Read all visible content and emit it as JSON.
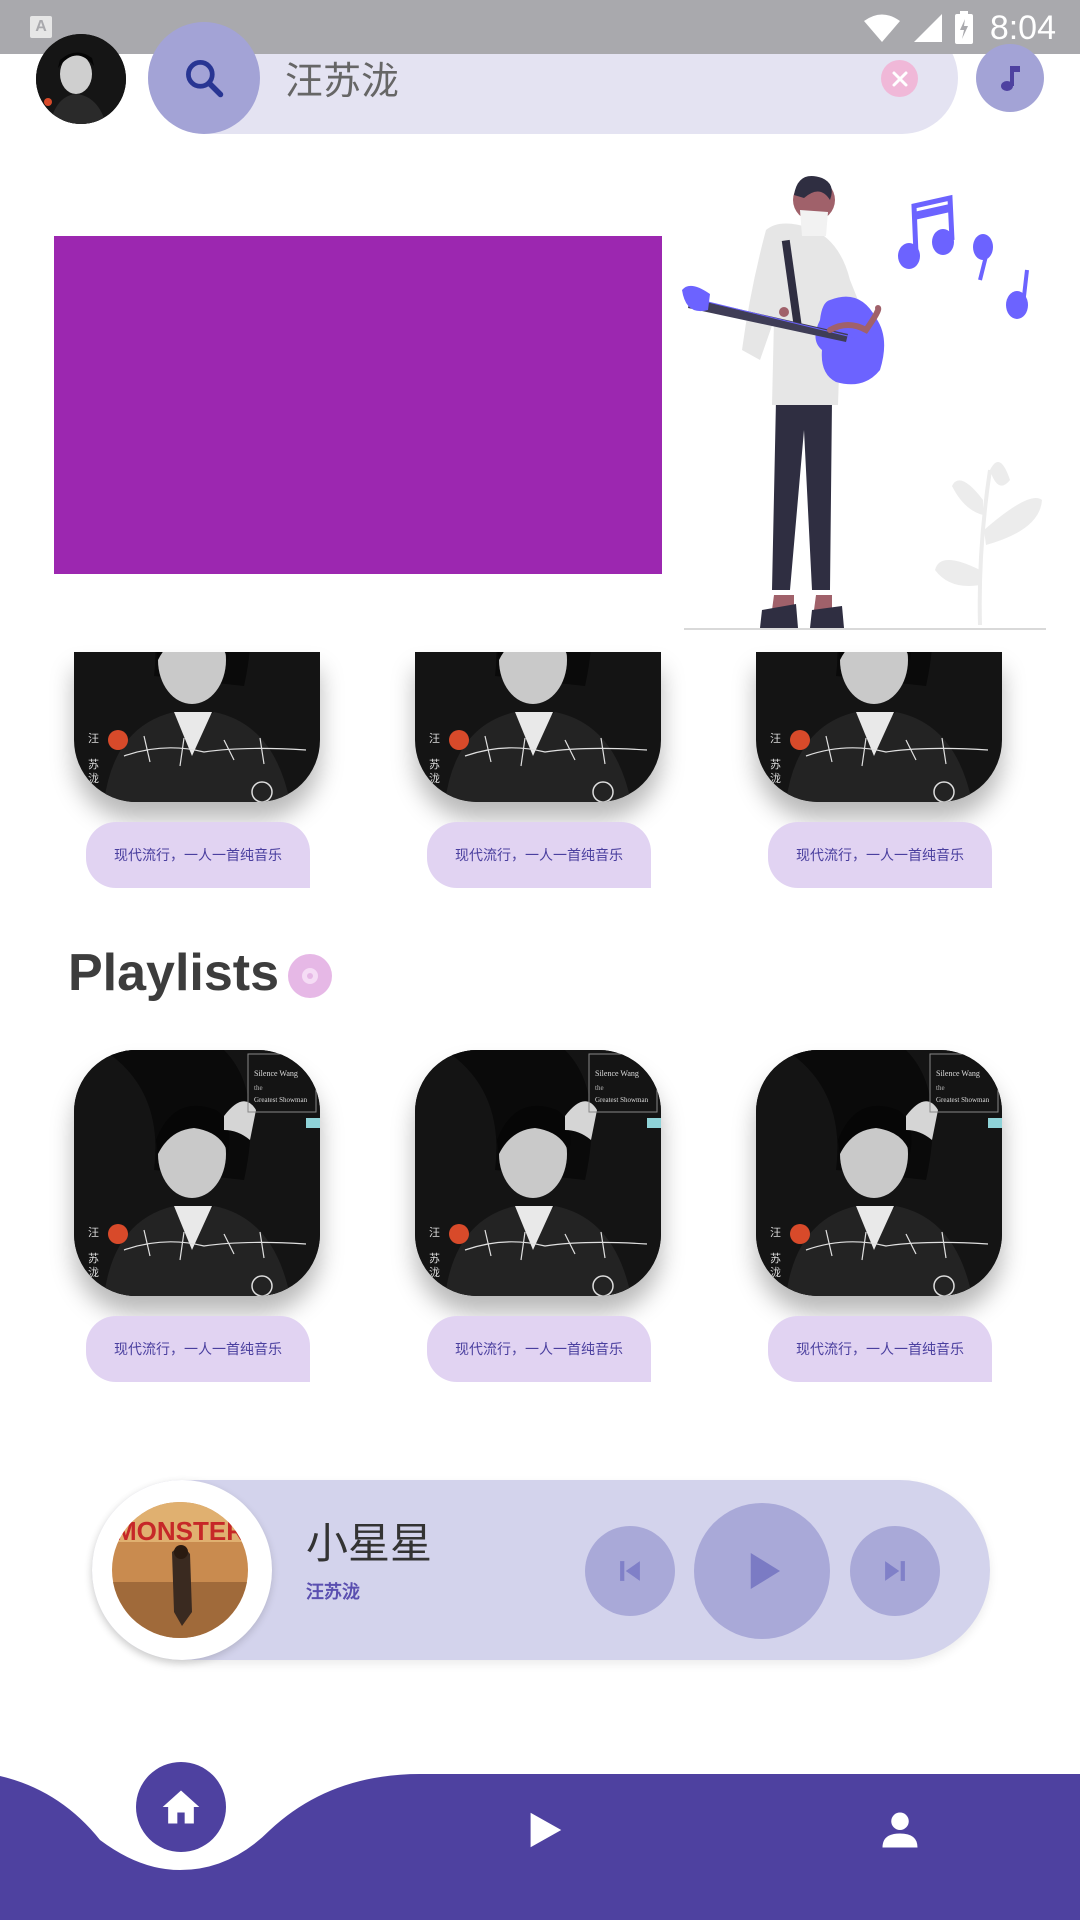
{
  "status_bar": {
    "time": "8:04"
  },
  "search": {
    "query": "汪苏泷"
  },
  "trending_row": {
    "items": [
      {
        "label": "现代流行，一人一首纯音乐"
      },
      {
        "label": "现代流行，一人一首纯音乐"
      },
      {
        "label": "现代流行，一人一首纯音乐"
      }
    ]
  },
  "playlists": {
    "title": "Playlists",
    "items": [
      {
        "label": "现代流行，一人一首纯音乐"
      },
      {
        "label": "现代流行，一人一首纯音乐"
      },
      {
        "label": "现代流行，一人一首纯音乐"
      }
    ]
  },
  "cover_art": {
    "text_1": "Silence Wang",
    "text_2": "the",
    "text_3": "Greatest Showman",
    "text_4": "汪",
    "text_5": "苏",
    "text_6": "泷"
  },
  "player": {
    "song_title": "小星星",
    "artist": "汪苏泷",
    "art_text": "MONSTER"
  },
  "colors": {
    "accent": "#4e41a0",
    "banner": "#9c27b0",
    "soft": "#d3d3ec",
    "label_bg": "#e1d3f2"
  },
  "icons": [
    "search-icon",
    "close-icon",
    "music-note-icon",
    "disc-icon",
    "skip-previous-icon",
    "play-icon",
    "skip-next-icon",
    "home-icon",
    "profile-icon"
  ]
}
